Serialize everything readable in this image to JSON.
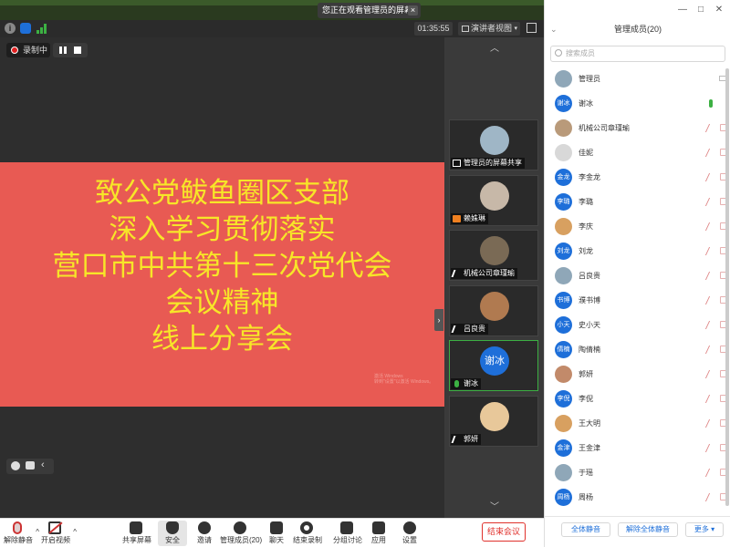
{
  "share_banner": {
    "text": "您正在观看管理员的屏幕",
    "close": "×"
  },
  "toolbar": {
    "timer": "01:35:55",
    "view_label": "演讲者视图",
    "view_caret": "▾"
  },
  "recording": {
    "label": "录制中"
  },
  "slide": {
    "lines": [
      "致公党鲅鱼圈区支部",
      "深入学习贯彻落实",
      "营口市中共第十三次党代会",
      "会议精神",
      "线上分享会"
    ],
    "watermark_line1": "激活 Windows",
    "watermark_line2": "转到\"设置\"以激活 Windows。"
  },
  "gallery": {
    "up": "︿",
    "down": "﹀",
    "tiles": [
      {
        "name": "管理员的屏幕共享",
        "icon": "screen-share-icon"
      },
      {
        "name": "赖姝琳",
        "icon": "person-icon"
      },
      {
        "name": "机械公司章瑾瑜",
        "icon": "mic-off-icon"
      },
      {
        "name": "吕良贵",
        "icon": "mic-off-icon"
      },
      {
        "name": "谢冰",
        "icon": "mic-on-icon",
        "avatar_text": "谢冰"
      },
      {
        "name": "郭妍",
        "icon": "mic-off-icon"
      }
    ]
  },
  "bottom_bar": {
    "unmute": "解除静音",
    "start_video": "开启视频",
    "share_screen": "共享屏幕",
    "security": "安全",
    "invite": "邀请",
    "members": "管理成员(20)",
    "chat": "聊天",
    "end_recording": "结束录制",
    "breakout": "分组讨论",
    "apps": "应用",
    "settings": "设置",
    "end_meeting": "结束会议",
    "caret": "^"
  },
  "panel": {
    "title": "管理成员(20)",
    "chevron": "⌄",
    "window_controls": {
      "minimize": "—",
      "maximize": "□",
      "close": "✕"
    },
    "search_placeholder": "搜索成员",
    "members": [
      {
        "name": "管理员",
        "avatar": "",
        "avatar_style": "photo",
        "mic": "host"
      },
      {
        "name": "谢冰",
        "avatar": "谢冰",
        "avatar_style": "blue",
        "mic": "on"
      },
      {
        "name": "机械公司章瑾瑜",
        "avatar": "",
        "avatar_style": "photo",
        "mic": "off"
      },
      {
        "name": "佳妮",
        "avatar": "",
        "avatar_style": "grey",
        "mic": "off"
      },
      {
        "name": "李金龙",
        "avatar": "金龙",
        "avatar_style": "blue",
        "mic": "off"
      },
      {
        "name": "李璐",
        "avatar": "李璐",
        "avatar_style": "blue",
        "mic": "off"
      },
      {
        "name": "李庆",
        "avatar": "",
        "avatar_style": "photo",
        "mic": "off"
      },
      {
        "name": "刘龙",
        "avatar": "刘龙",
        "avatar_style": "blue",
        "mic": "off"
      },
      {
        "name": "吕良贵",
        "avatar": "",
        "avatar_style": "photo",
        "mic": "off"
      },
      {
        "name": "濮书博",
        "avatar": "书博",
        "avatar_style": "blue",
        "mic": "off"
      },
      {
        "name": "史小天",
        "avatar": "小天",
        "avatar_style": "blue",
        "mic": "off"
      },
      {
        "name": "陶倩楠",
        "avatar": "倩楠",
        "avatar_style": "blue",
        "mic": "off"
      },
      {
        "name": "郭妍",
        "avatar": "",
        "avatar_style": "photo",
        "mic": "off"
      },
      {
        "name": "李倪",
        "avatar": "李倪",
        "avatar_style": "blue",
        "mic": "off"
      },
      {
        "name": "王大明",
        "avatar": "",
        "avatar_style": "photo",
        "mic": "off"
      },
      {
        "name": "王金津",
        "avatar": "金津",
        "avatar_style": "blue",
        "mic": "off"
      },
      {
        "name": "于瑶",
        "avatar": "",
        "avatar_style": "photo",
        "mic": "off"
      },
      {
        "name": "周杨",
        "avatar": "周杨",
        "avatar_style": "blue",
        "mic": "off"
      }
    ],
    "mute_all": "全体静音",
    "unmute_all": "解除全体静音",
    "more": "更多 ▾"
  },
  "colors": {
    "slide_bg": "#e85a53",
    "slide_text": "#f7e628",
    "accent": "#1e6fd9",
    "end": "#e0312c"
  }
}
